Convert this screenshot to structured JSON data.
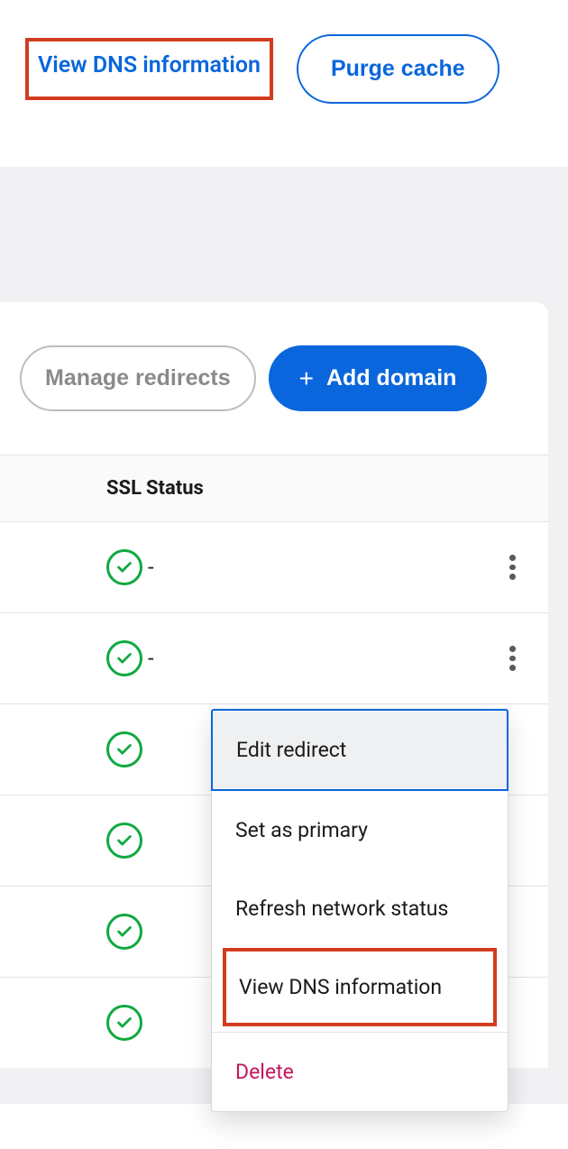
{
  "topLinks": {
    "viewDns": "View DNS information",
    "purgeCache": "Purge cache"
  },
  "cardButtons": {
    "manageRedirects": "Manage redirects",
    "addDomain": "Add domain"
  },
  "table": {
    "headers": {
      "ssl": "SSL",
      "status": "Status"
    },
    "rows": [
      {
        "status": "-"
      },
      {
        "status": "-"
      },
      {
        "status": ""
      },
      {
        "status": ""
      },
      {
        "status": ""
      },
      {
        "status": ""
      }
    ]
  },
  "dropdown": {
    "editRedirect": "Edit redirect",
    "setPrimary": "Set as primary",
    "refreshNetwork": "Refresh network status",
    "viewDns": "View DNS information",
    "delete": "Delete"
  }
}
